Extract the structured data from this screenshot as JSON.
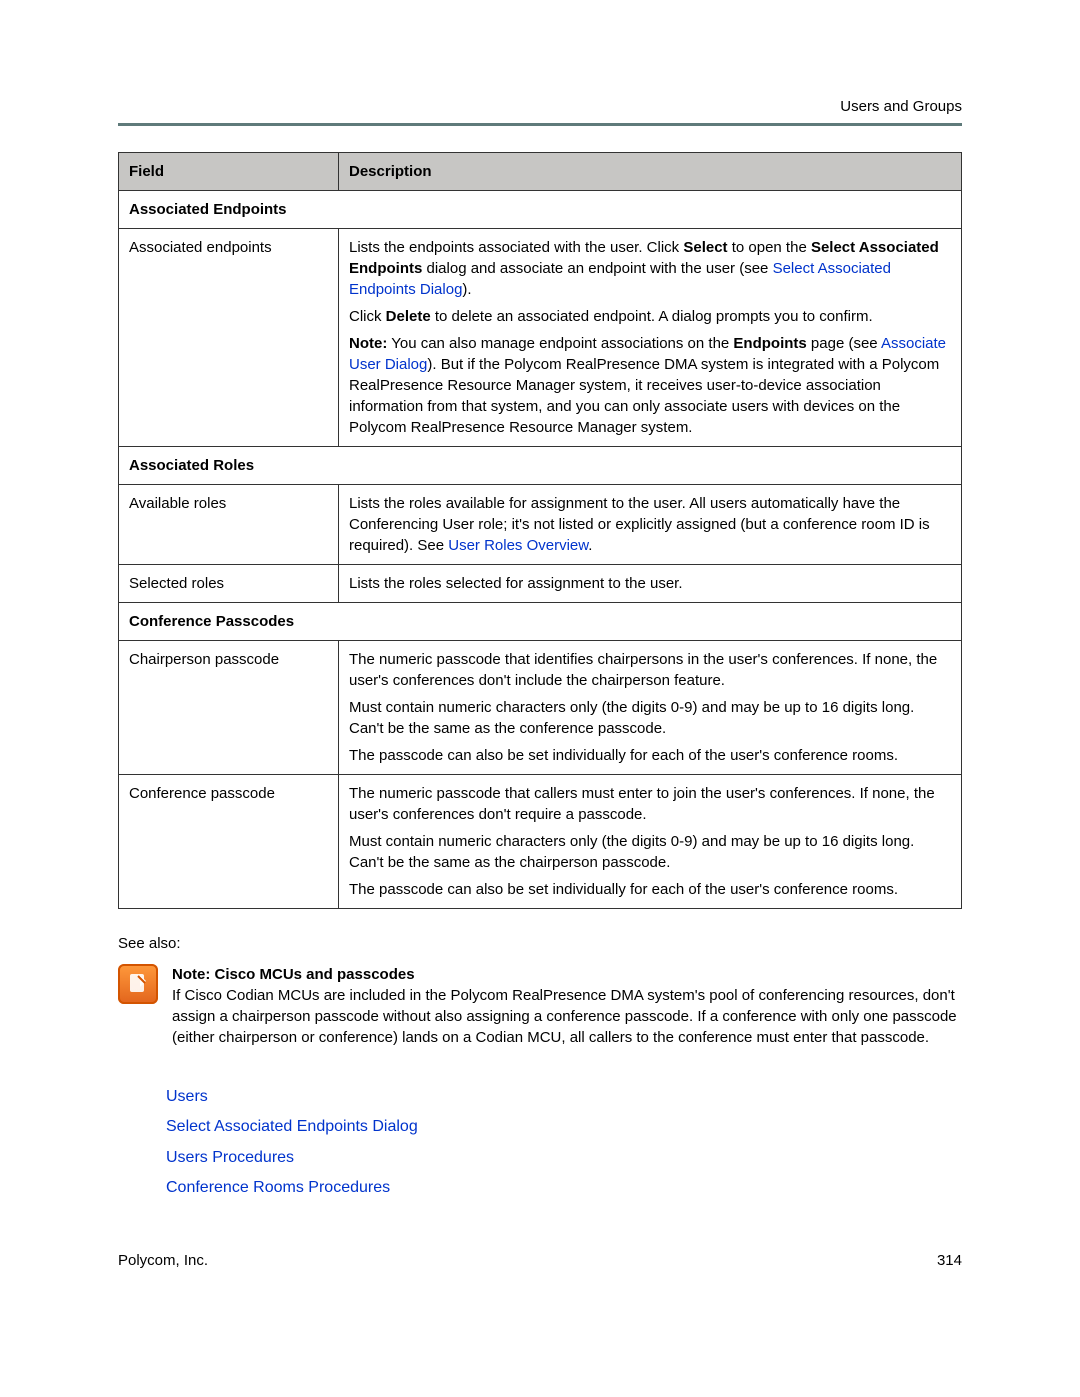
{
  "header": {
    "section": "Users and Groups"
  },
  "table": {
    "head": {
      "field": "Field",
      "description": "Description"
    },
    "section1": {
      "title": "Associated Endpoints"
    },
    "row_assoc_endpoints": {
      "field": "Associated endpoints",
      "p1a": "Lists the endpoints associated with the user. Click ",
      "p1b": "Select",
      "p1c": " to open the ",
      "p1d": "Select Associated Endpoints",
      "p1e": " dialog and associate an endpoint with the user (see ",
      "p1link": "Select Associated Endpoints Dialog",
      "p1f": ").",
      "p2a": "Click ",
      "p2b": "Delete",
      "p2c": " to delete an associated endpoint. A dialog prompts you to confirm.",
      "p3a": "Note:",
      "p3b": " You can also manage endpoint associations on the ",
      "p3c": "Endpoints",
      "p3d": " page (see ",
      "p3link": "Associate User Dialog",
      "p3e": "). But if the Polycom RealPresence DMA system is integrated with a Polycom RealPresence Resource Manager system, it receives user-to-device association information from that system, and you can only associate users with devices on the Polycom RealPresence Resource Manager system."
    },
    "section2": {
      "title": "Associated Roles"
    },
    "row_available_roles": {
      "field": "Available roles",
      "p1a": "Lists the roles available for assignment to the user. All users automatically have the Conferencing User role; it's not listed or explicitly assigned (but a conference room ID is required). See ",
      "p1link": "User Roles Overview",
      "p1b": "."
    },
    "row_selected_roles": {
      "field": "Selected roles",
      "desc": "Lists the roles selected for assignment to the user."
    },
    "section3": {
      "title": "Conference Passcodes"
    },
    "row_chair": {
      "field": "Chairperson passcode",
      "p1": "The numeric passcode that identifies chairpersons in the user's conferences. If none, the user's conferences don't include the chairperson feature.",
      "p2": "Must contain numeric characters only (the digits 0-9) and may be up to 16 digits long. Can't be the same as the conference passcode.",
      "p3": "The passcode can also be set individually for each of the user's conference rooms."
    },
    "row_conf": {
      "field": "Conference passcode",
      "p1": "The numeric passcode that callers must enter to join the user's conferences. If none, the user's conferences don't require a passcode.",
      "p2": "Must contain numeric characters only (the digits 0-9) and may be up to 16 digits long. Can't be the same as the chairperson passcode.",
      "p3": "The passcode can also be set individually for each of the user's conference rooms."
    }
  },
  "see_also_label": "See also:",
  "note": {
    "title": "Note: Cisco MCUs and passcodes",
    "body": "If Cisco Codian MCUs are included in the Polycom RealPresence DMA system's pool of conferencing resources, don't assign a chairperson passcode without also assigning a conference passcode. If a conference with only one passcode (either chairperson or conference) lands on a Codian MCU, all callers to the conference must enter that passcode."
  },
  "related_links": {
    "l1": "Users",
    "l2": "Select Associated Endpoints Dialog",
    "l3": "Users Procedures",
    "l4": "Conference Rooms Procedures"
  },
  "footer": {
    "company": "Polycom, Inc.",
    "page": "314"
  }
}
